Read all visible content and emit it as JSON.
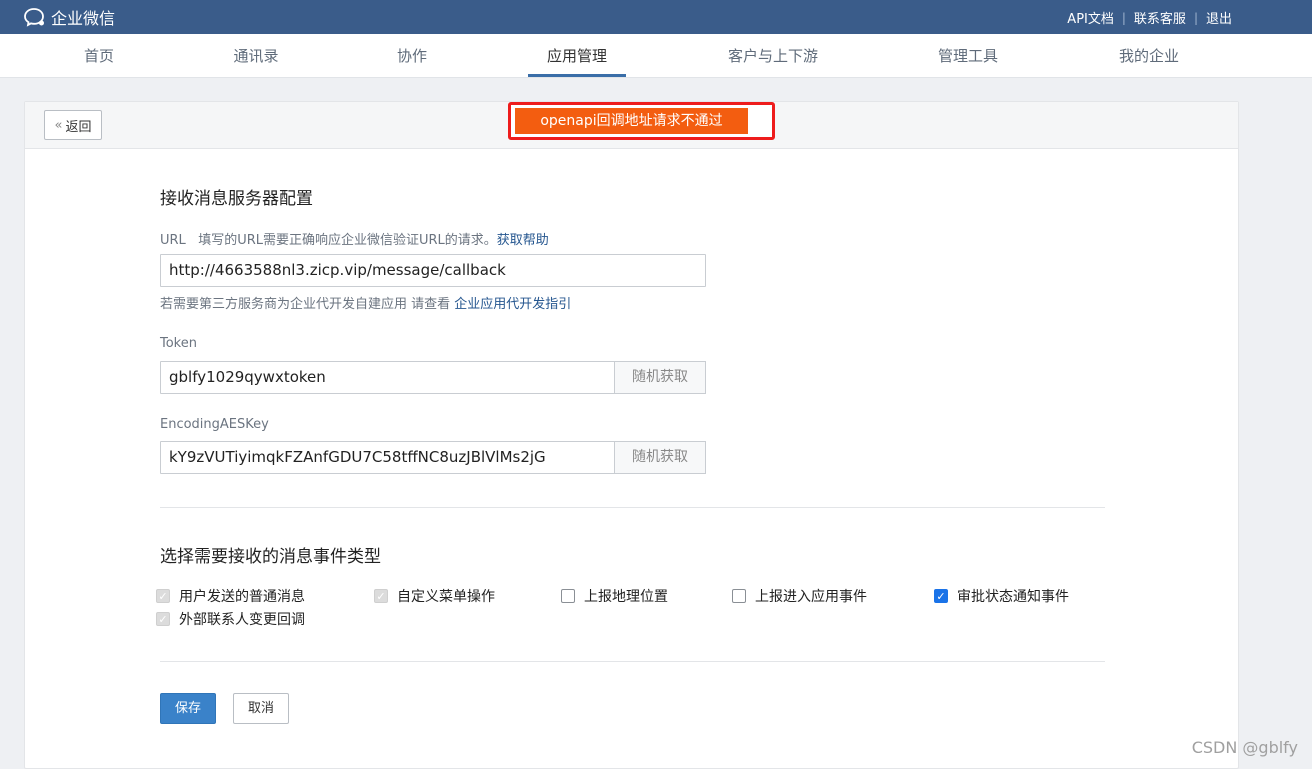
{
  "app": {
    "logo_text": "企业微信"
  },
  "header_links": [
    "API文档",
    "联系客服",
    "退出"
  ],
  "nav": {
    "items": [
      "首页",
      "通讯录",
      "协作",
      "应用管理",
      "客户与上下游",
      "管理工具",
      "我的企业"
    ],
    "active": "应用管理"
  },
  "toolbar": {
    "back_label": "返回"
  },
  "alert": {
    "text": "openapi回调地址请求不通过"
  },
  "server_config": {
    "title": "接收消息服务器配置",
    "url_label": "URL",
    "url_desc": "填写的URL需要正确响应企业微信验证URL的请求。",
    "url_help": "获取帮助",
    "url_value": "http://4663588nl3.zicp.vip/message/callback",
    "hint_prefix": "若需要第三方服务商为企业代开发自建应用 请查看",
    "hint_link": "企业应用代开发指引",
    "token_label": "Token",
    "token_value": "gblfy1029qywxtoken",
    "aes_label": "EncodingAESKey",
    "aes_value": "kY9zVUTiyimqkFZAnfGDU7C58tffNC8uzJBlVlMs2jG",
    "random_label": "随机获取"
  },
  "events": {
    "title": "选择需要接收的消息事件类型",
    "items": [
      {
        "label": "用户发送的普通消息",
        "state": "checked-disabled"
      },
      {
        "label": "自定义菜单操作",
        "state": "checked-disabled"
      },
      {
        "label": "上报地理位置",
        "state": "unchecked"
      },
      {
        "label": "上报进入应用事件",
        "state": "unchecked"
      },
      {
        "label": "审批状态通知事件",
        "state": "checked"
      },
      {
        "label": "外部联系人变更回调",
        "state": "checked-disabled"
      }
    ]
  },
  "actions": {
    "save": "保存",
    "cancel": "取消"
  },
  "watermark": "CSDN @gblfy"
}
